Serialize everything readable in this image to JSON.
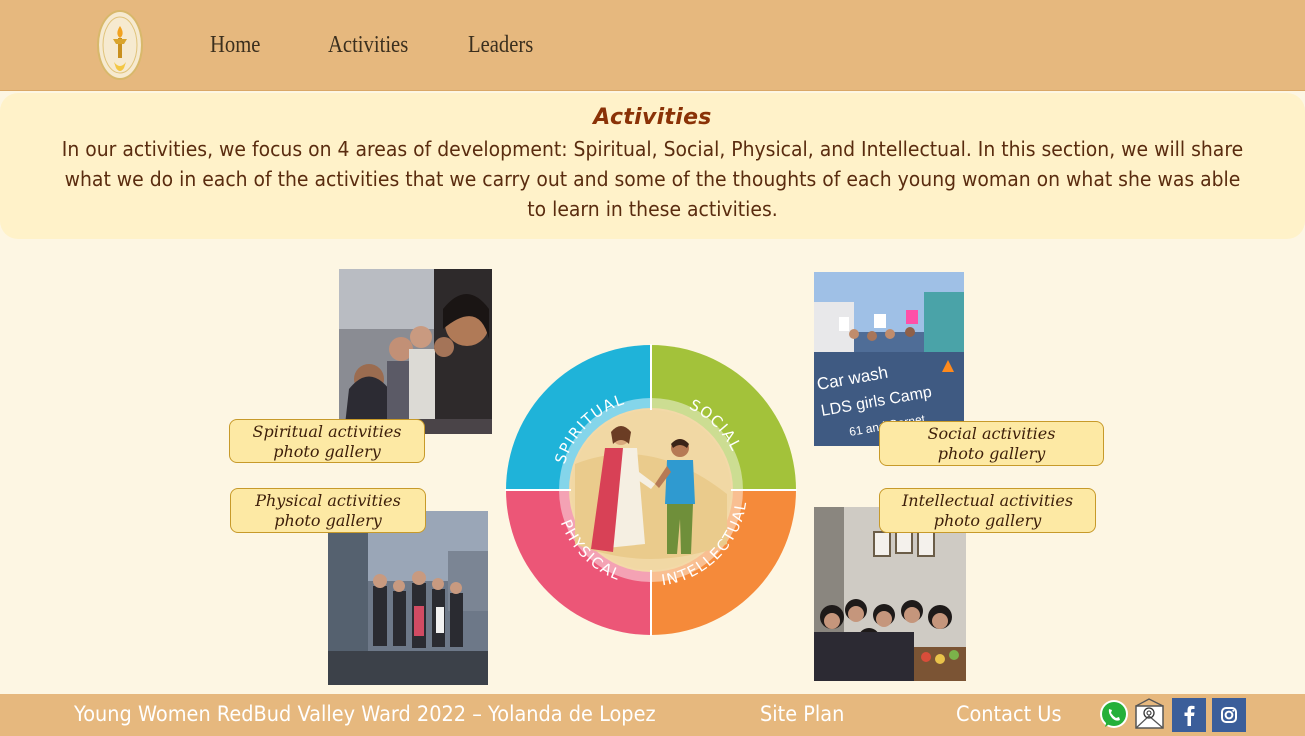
{
  "nav": {
    "home": "Home",
    "activities": "Activities",
    "leaders": "Leaders"
  },
  "intro": {
    "title": "Activities",
    "text": "In our activities, we focus on 4 areas of development: Spiritual, Social, Physical, and Intellectual. In this section, we will share what we do in each of the activities that we carry out and some of the thoughts of each young woman on what she was able to learn in these activities."
  },
  "galleries": {
    "spiritual": [
      "Spiritual activities",
      "photo gallery"
    ],
    "social": [
      "Social activities",
      "photo gallery"
    ],
    "physical": [
      "Physical activities",
      "photo gallery"
    ],
    "intellectual": [
      "Intellectual activities",
      "photo gallery"
    ]
  },
  "social_photo_caption": [
    "Car wash",
    "LDS girls Camp",
    "61 and Garnet"
  ],
  "wheel": {
    "spiritual": "SPIRITUAL",
    "social": "SOCIAL",
    "physical": "PHYSICAL",
    "intellectual": "INTELLECTUAL",
    "colors": {
      "spiritual": "#1fb3d9",
      "social": "#a3c23a",
      "physical": "#ec5677",
      "intellectual": "#f58a3a"
    }
  },
  "footer": {
    "credit": "Young Women RedBud Valley Ward  2022 – Yolanda de Lopez",
    "site_plan": "Site Plan",
    "contact": "Contact Us"
  },
  "icons": [
    "whatsapp-icon",
    "email-icon",
    "facebook-icon",
    "instagram-icon"
  ]
}
